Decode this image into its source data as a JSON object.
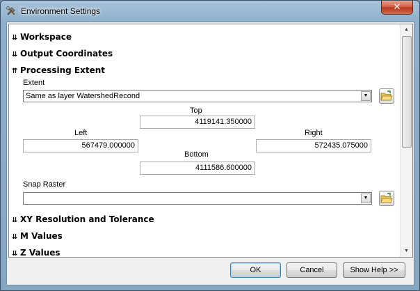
{
  "window": {
    "title": "Environment Settings",
    "close_symbol": "✕"
  },
  "sections": {
    "workspace": "Workspace",
    "output_coordinates": "Output Coordinates",
    "processing_extent": "Processing Extent",
    "xy_resolution": "XY Resolution and Tolerance",
    "m_values": "M Values",
    "z_values": "Z Values"
  },
  "extent": {
    "label": "Extent",
    "selected": "Same as layer WatershedRecond",
    "top_label": "Top",
    "top_value": "4119141.350000",
    "left_label": "Left",
    "left_value": "567479.000000",
    "right_label": "Right",
    "right_value": "572435.075000",
    "bottom_label": "Bottom",
    "bottom_value": "4111586.600000"
  },
  "snap_raster": {
    "label": "Snap Raster",
    "value": ""
  },
  "buttons": {
    "ok": "OK",
    "cancel": "Cancel",
    "show_help": "Show Help >>"
  },
  "icons": {
    "window_icon": "tools-icon",
    "extent_browse": "open-folder-icon",
    "snap_browse": "open-folder-icon"
  }
}
